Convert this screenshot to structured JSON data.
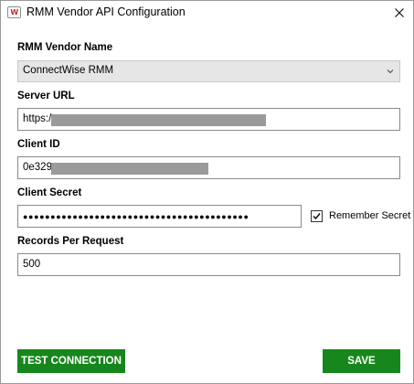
{
  "window": {
    "title": "RMM Vendor API Configuration",
    "icon_name": "app-logo-icon",
    "icon_text": "W"
  },
  "form": {
    "vendor": {
      "label": "RMM Vendor Name",
      "value": "ConnectWise RMM"
    },
    "server_url": {
      "label": "Server URL",
      "value": "https:/"
    },
    "client_id": {
      "label": "Client ID",
      "value": "0e329"
    },
    "client_secret": {
      "label": "Client Secret",
      "value": "●●●●●●●●●●●●●●●●●●●●●●●●●●●●●●●●●●●●●●●●●"
    },
    "remember_secret": {
      "label": "Remember Secret",
      "checked": true
    },
    "records_per_request": {
      "label": "Records Per Request",
      "value": "500"
    }
  },
  "buttons": {
    "test_connection": "TEST CONNECTION",
    "save": "SAVE"
  },
  "colors": {
    "button_green": "#17871d",
    "redaction_gray": "#9a9a9a"
  }
}
